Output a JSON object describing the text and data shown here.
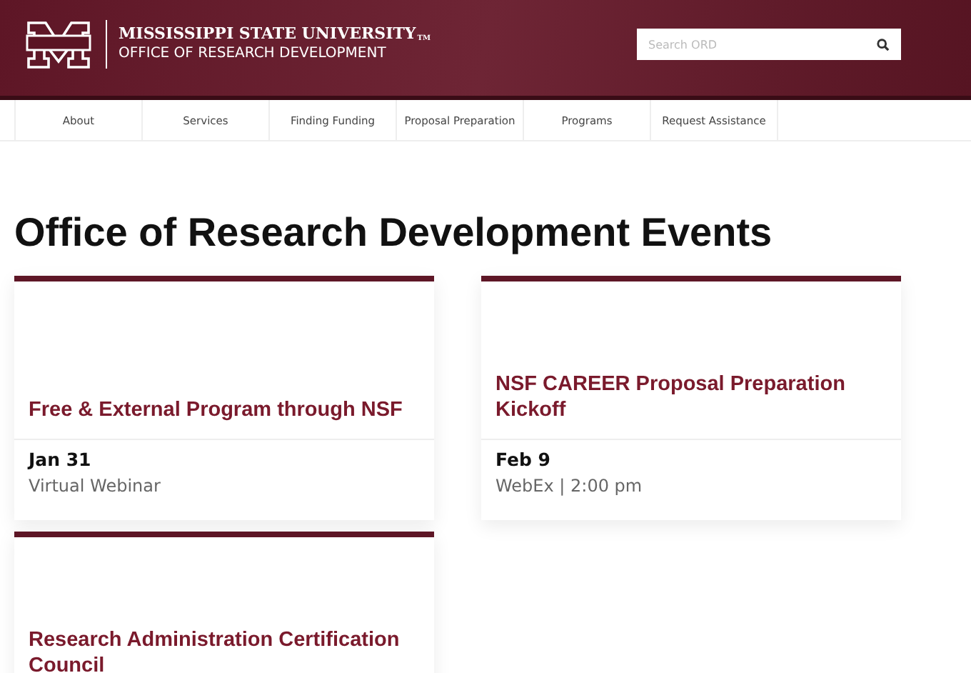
{
  "header": {
    "university": "MISSISSIPPI STATE UNIVERSITY",
    "trademark": "TM",
    "office": "OFFICE OF RESEARCH DEVELOPMENT",
    "search": {
      "placeholder": "Search ORD"
    }
  },
  "nav": [
    "About",
    "Services",
    "Finding Funding",
    "Proposal Preparation",
    "Programs",
    "Request Assistance"
  ],
  "page_title": "Office of Research Development Events",
  "events": [
    {
      "title": "Free & External Program through NSF",
      "date": "Jan 31",
      "location": "Virtual Webinar"
    },
    {
      "title": "NSF CAREER Proposal Preparation Kickoff",
      "date": "Feb 9",
      "location": "WebEx | 2:00 pm"
    },
    {
      "title": "Research Administration Certification Council"
    }
  ]
}
